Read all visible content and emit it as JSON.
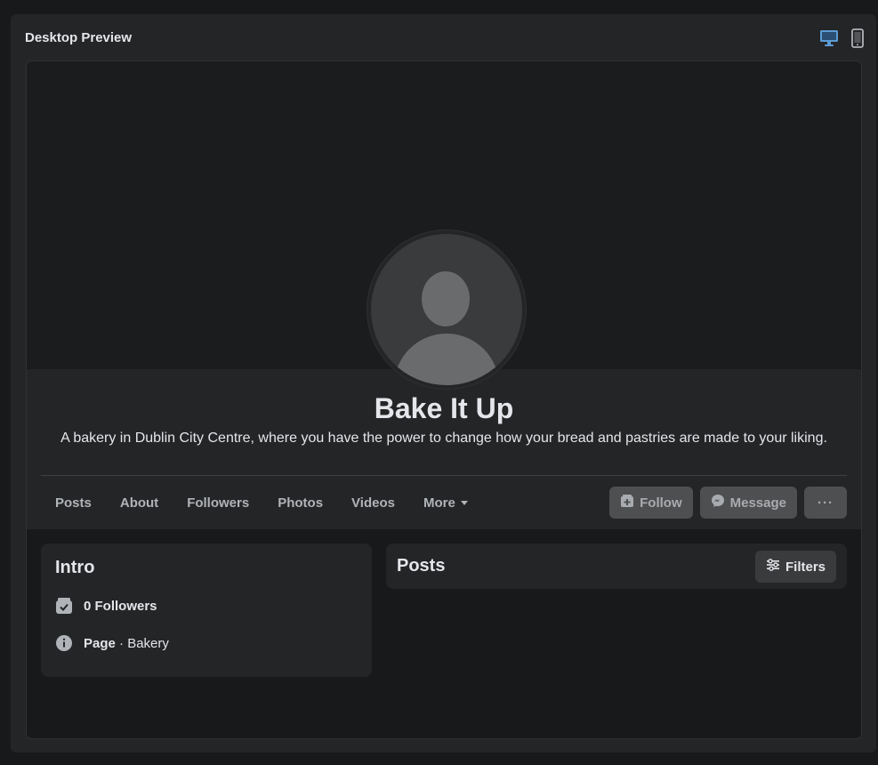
{
  "panel": {
    "title": "Desktop Preview"
  },
  "view_toggle": {
    "desktop_icon": "desktop-monitor-icon",
    "mobile_icon": "mobile-phone-icon",
    "active_color": "#5b9bd5"
  },
  "page": {
    "name": "Bake It Up",
    "description": "A bakery in Dublin City Centre, where you have the power to change how your bread and pastries are made to your liking."
  },
  "tabs": [
    {
      "label": "Posts"
    },
    {
      "label": "About"
    },
    {
      "label": "Followers"
    },
    {
      "label": "Photos"
    },
    {
      "label": "Videos"
    },
    {
      "label": "More"
    }
  ],
  "actions": {
    "follow_label": "Follow",
    "message_label": "Message",
    "more_label": "···"
  },
  "intro": {
    "title": "Intro",
    "followers": "0 Followers",
    "page_label": "Page",
    "page_category": " · Bakery"
  },
  "posts": {
    "title": "Posts",
    "filters_label": "Filters"
  },
  "colors": {
    "background": "#18191a",
    "card": "#242526",
    "text": "#e4e6eb",
    "muted": "#b0b3b8",
    "disabled_button": "#4e4f50"
  }
}
